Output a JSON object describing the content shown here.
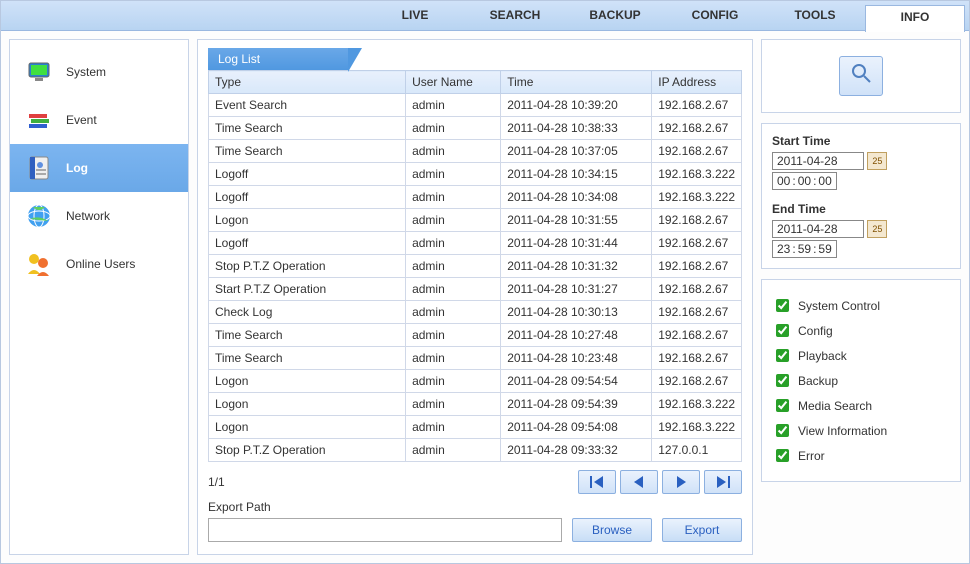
{
  "topnav": {
    "tabs": [
      "LIVE",
      "SEARCH",
      "BACKUP",
      "CONFIG",
      "TOOLS",
      "INFO"
    ],
    "active": 5
  },
  "sidebar": {
    "items": [
      {
        "id": "system",
        "label": "System"
      },
      {
        "id": "event",
        "label": "Event"
      },
      {
        "id": "log",
        "label": "Log"
      },
      {
        "id": "network",
        "label": "Network"
      },
      {
        "id": "online-users",
        "label": "Online Users"
      }
    ],
    "active": 2
  },
  "log_panel": {
    "tab_label": "Log List",
    "headers": {
      "type": "Type",
      "user": "User Name",
      "time": "Time",
      "ip": "IP Address"
    },
    "rows": [
      {
        "type": "Event Search",
        "user": "admin",
        "time": "2011-04-28 10:39:20",
        "ip": "192.168.2.67"
      },
      {
        "type": "Time Search",
        "user": "admin",
        "time": "2011-04-28 10:38:33",
        "ip": "192.168.2.67"
      },
      {
        "type": "Time Search",
        "user": "admin",
        "time": "2011-04-28 10:37:05",
        "ip": "192.168.2.67"
      },
      {
        "type": "Logoff",
        "user": "admin",
        "time": "2011-04-28 10:34:15",
        "ip": "192.168.3.222"
      },
      {
        "type": "Logoff",
        "user": "admin",
        "time": "2011-04-28 10:34:08",
        "ip": "192.168.3.222"
      },
      {
        "type": "Logon",
        "user": "admin",
        "time": "2011-04-28 10:31:55",
        "ip": "192.168.2.67"
      },
      {
        "type": "Logoff",
        "user": "admin",
        "time": "2011-04-28 10:31:44",
        "ip": "192.168.2.67"
      },
      {
        "type": "Stop P.T.Z Operation",
        "user": "admin",
        "time": "2011-04-28 10:31:32",
        "ip": "192.168.2.67"
      },
      {
        "type": "Start P.T.Z Operation",
        "user": "admin",
        "time": "2011-04-28 10:31:27",
        "ip": "192.168.2.67"
      },
      {
        "type": "Check Log",
        "user": "admin",
        "time": "2011-04-28 10:30:13",
        "ip": "192.168.2.67"
      },
      {
        "type": "Time Search",
        "user": "admin",
        "time": "2011-04-28 10:27:48",
        "ip": "192.168.2.67"
      },
      {
        "type": "Time Search",
        "user": "admin",
        "time": "2011-04-28 10:23:48",
        "ip": "192.168.2.67"
      },
      {
        "type": "Logon",
        "user": "admin",
        "time": "2011-04-28 09:54:54",
        "ip": "192.168.2.67"
      },
      {
        "type": "Logon",
        "user": "admin",
        "time": "2011-04-28 09:54:39",
        "ip": "192.168.3.222"
      },
      {
        "type": "Logon",
        "user": "admin",
        "time": "2011-04-28 09:54:08",
        "ip": "192.168.3.222"
      },
      {
        "type": "Stop P.T.Z Operation",
        "user": "admin",
        "time": "2011-04-28 09:33:32",
        "ip": "127.0.0.1"
      }
    ],
    "page_indicator": "1/1",
    "export_path_label": "Export Path",
    "export_path_value": "",
    "browse_label": "Browse",
    "export_label": "Export"
  },
  "filter": {
    "start_label": "Start Time",
    "start_date": "2011-04-28",
    "start_hh": "00",
    "start_mm": "00",
    "start_ss": "00",
    "end_label": "End Time",
    "end_date": "2011-04-28",
    "end_hh": "23",
    "end_mm": "59",
    "end_ss": "59",
    "cal_day": "25"
  },
  "categories": [
    {
      "label": "System Control",
      "checked": true
    },
    {
      "label": "Config",
      "checked": true
    },
    {
      "label": "Playback",
      "checked": true
    },
    {
      "label": "Backup",
      "checked": true
    },
    {
      "label": "Media Search",
      "checked": true
    },
    {
      "label": "View Information",
      "checked": true
    },
    {
      "label": "Error",
      "checked": true
    }
  ]
}
